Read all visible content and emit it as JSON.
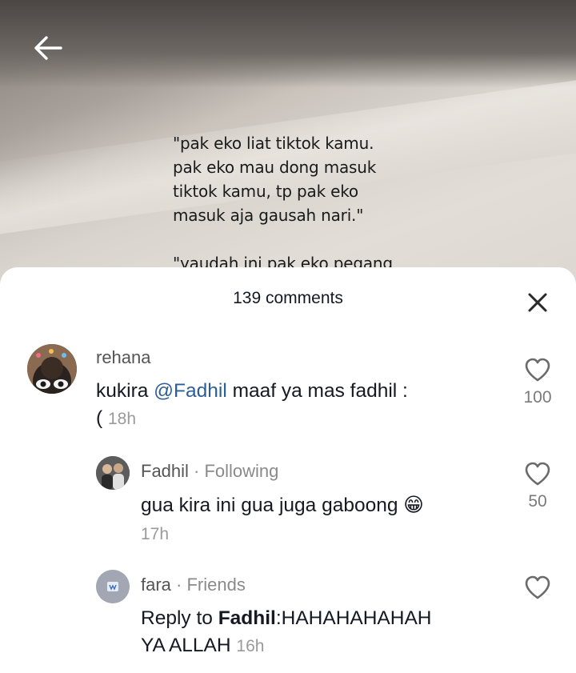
{
  "video": {
    "caption": "\"pak eko liat tiktok kamu.\npak eko mau dong masuk\ntiktok kamu, tp pak eko\nmasuk aja gausah nari.\"\n\n\"yaudah ini pak eko pegang"
  },
  "sheet": {
    "comment_count": "139 comments"
  },
  "icons": {
    "back": "back-arrow-icon",
    "close": "close-icon",
    "like": "heart-outline-icon",
    "emoji": "grinning-face-emoji"
  },
  "comments": [
    {
      "username": "rehana",
      "text_before": "kukira ",
      "mention": "@Fadhil",
      "text_after": " maaf ya mas fadhil :\n( ",
      "time": "18h",
      "likes": "100"
    },
    {
      "username": "Fadhil",
      "relation": " · Following",
      "text": "gua kira ini gua juga gaboong ",
      "emoji": "😁",
      "time": "17h",
      "likes": "50"
    },
    {
      "username": "fara",
      "relation": " · Friends",
      "reply_prefix": "Reply to ",
      "reply_to": "Fadhil",
      "text": ":HAHAHAHAHAH\nYA ALLAH ",
      "time": "16h",
      "likes": ""
    }
  ],
  "colors": {
    "mention": "#2b5d9a",
    "text": "#161823",
    "muted": "#9a9a9a"
  }
}
